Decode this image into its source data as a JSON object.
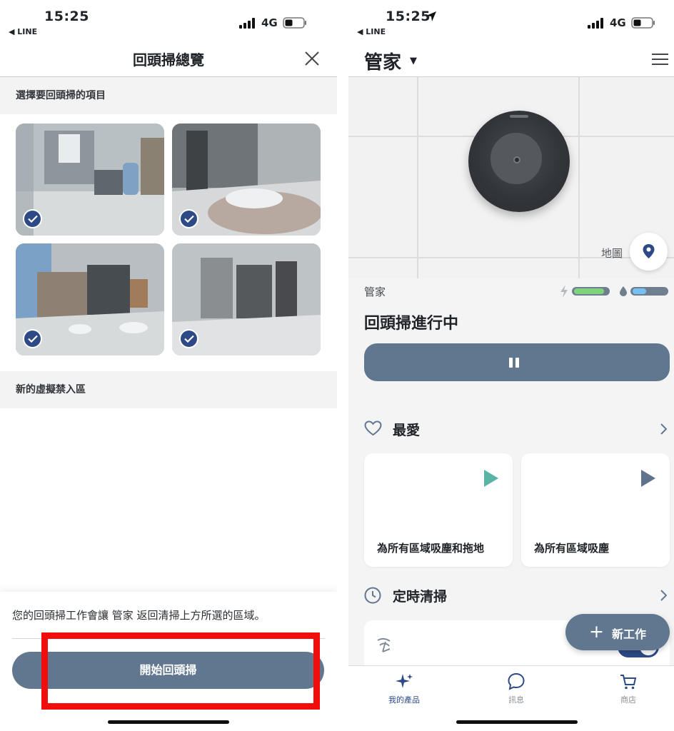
{
  "left": {
    "status": {
      "time": "15:25",
      "back_app": "◀ LINE",
      "network": "4G"
    },
    "title": "回頭掃總覽",
    "section_select": "選擇要回頭掃的項目",
    "section_zone": "新的虛擬禁入區",
    "thumbnails_selected": [
      true,
      true,
      true,
      true
    ],
    "message": "您的回頭掃工作會讓 管家 返回清掃上方所選的區域。",
    "start_button": "開始回頭掃"
  },
  "right": {
    "status": {
      "time": "15:25",
      "back_app": "◀ LINE",
      "network": "4G"
    },
    "robot_title": "管家",
    "map_label": "地圖",
    "robot_name": "管家",
    "battery_level": 0.9,
    "water_level": 0.4,
    "job_status": "回頭掃進行中",
    "favorites_title": "最愛",
    "favorites": [
      {
        "label": "為所有區域吸塵和拖地",
        "play_color": "#5bb3a7"
      },
      {
        "label": "為所有區域吸塵",
        "play_color": "#5f738c"
      }
    ],
    "schedule_title": "定時清掃",
    "fab_label": "新工作",
    "tabs": [
      {
        "label": "我的產品"
      },
      {
        "label": "訊息"
      },
      {
        "label": "商店"
      }
    ]
  },
  "colors": {
    "accent": "#617790",
    "checked": "#2d4a86",
    "highlight": "#f20d0d"
  }
}
